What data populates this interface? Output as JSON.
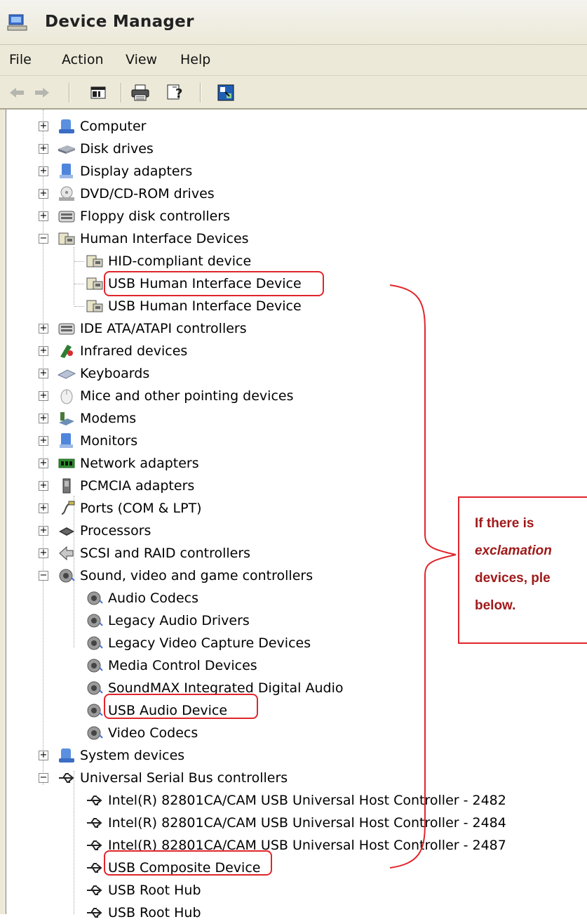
{
  "window": {
    "title": "Device Manager"
  },
  "menu": {
    "items": [
      "File",
      "Action",
      "View",
      "Help"
    ]
  },
  "toolbar": {
    "buttons": [
      "back-icon",
      "forward-icon",
      "show-hide-console-tree-icon",
      "print-icon",
      "help-icon",
      "update-driver-icon"
    ]
  },
  "tree": {
    "computer": "Computer",
    "disk_drives": "Disk drives",
    "display_adapters": "Display adapters",
    "dvd_cdrom": "DVD/CD-ROM drives",
    "floppy": "Floppy disk controllers",
    "hid": "Human Interface Devices",
    "hid_children": [
      "HID-compliant device",
      "USB Human Interface Device",
      "USB Human Interface Device"
    ],
    "ide": "IDE ATA/ATAPI controllers",
    "infrared": "Infrared devices",
    "keyboards": "Keyboards",
    "mice": "Mice and other pointing devices",
    "modems": "Modems",
    "monitors": "Monitors",
    "network": "Network adapters",
    "pcmcia": "PCMCIA adapters",
    "ports": "Ports (COM & LPT)",
    "processors": "Processors",
    "scsi": "SCSI and RAID controllers",
    "sound": "Sound, video and game controllers",
    "sound_children": [
      "Audio Codecs",
      "Legacy Audio Drivers",
      "Legacy Video Capture Devices",
      "Media Control Devices",
      "SoundMAX Integrated Digital Audio",
      "USB Audio Device",
      "Video Codecs"
    ],
    "system": "System devices",
    "usb": "Universal Serial Bus controllers",
    "usb_children": [
      "Intel(R) 82801CA/CAM USB Universal Host Controller - 2482",
      "Intel(R) 82801CA/CAM USB Universal Host Controller - 2484",
      "Intel(R) 82801CA/CAM USB Universal Host Controller - 2487",
      "USB Composite Device",
      "USB Root Hub",
      "USB Root Hub"
    ]
  },
  "callout": {
    "line1": "If there is",
    "line2": "exclamation",
    "line3": "devices, ple",
    "line4": "below."
  },
  "colors": {
    "highlight": "#e0262b",
    "callout_text": "#a01a1a",
    "chrome": "#ece9d8"
  }
}
